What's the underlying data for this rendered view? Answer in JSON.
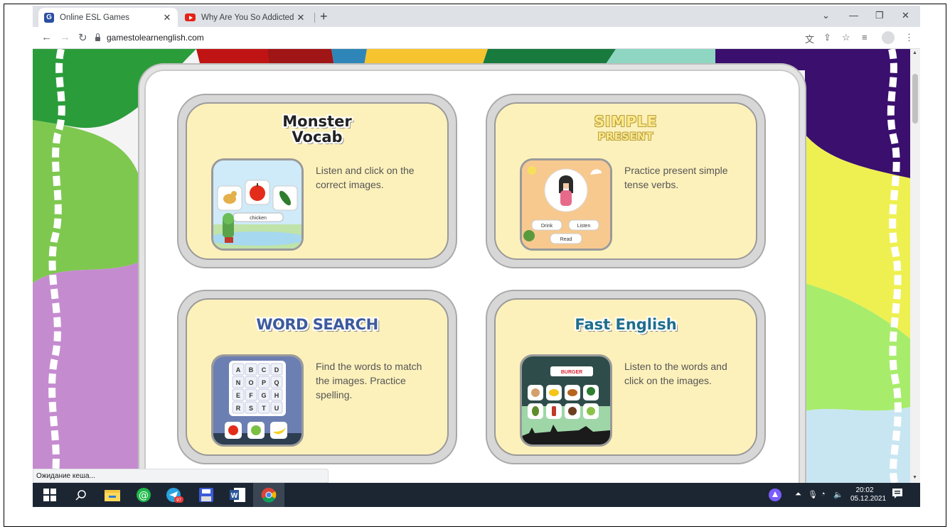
{
  "browser": {
    "tabs": [
      {
        "title": "Online ESL Games",
        "favicon": "G",
        "active": true
      },
      {
        "title": "Why Are You So Addicted To You",
        "favicon": "youtube",
        "active": false
      }
    ],
    "new_tab_label": "+",
    "close_glyph": "✕",
    "url": "gamestolearnenglish.com",
    "status_text": "Ожидание кеша..."
  },
  "games": [
    {
      "title_line1": "Monster",
      "title_line2": "Vocab",
      "description": "Listen and click on the correct images.",
      "thumb_word": "chicken"
    },
    {
      "title_line1": "SIMPLE",
      "title_line2": "PRESENT",
      "description": "Practice present simple tense verbs.",
      "thumb_words": [
        "Drink",
        "Listen",
        "Read"
      ]
    },
    {
      "title_line1": "WORD SEARCH",
      "title_line2": "",
      "description": "Find the words to match the images. Practice spelling.",
      "thumb_letters": [
        "A",
        "B",
        "C",
        "D",
        "N",
        "O",
        "P",
        "Q",
        "E",
        "F",
        "G",
        "H",
        "R",
        "S",
        "T",
        "U"
      ]
    },
    {
      "title_line1": "Fast English",
      "title_line2": "",
      "description": "Listen to the words and click on the images.",
      "thumb_word": "BURGER"
    }
  ],
  "taskbar": {
    "telegram_badge": "97",
    "time": "20:02",
    "date": "05.12.2021"
  },
  "colors": {
    "card_fill": "#fdf1bb",
    "taskbar": "#1c2633",
    "tab_strip": "#dee1e6"
  },
  "icons": [
    "back-icon",
    "forward-icon",
    "reload-icon",
    "lock-icon",
    "translate-icon",
    "share-icon",
    "star-icon",
    "media-icon",
    "profile-icon",
    "menu-icon",
    "windows-start-icon",
    "search-icon",
    "file-explorer-icon",
    "mail-icon",
    "telegram-icon",
    "save-icon",
    "word-icon",
    "chrome-icon"
  ]
}
